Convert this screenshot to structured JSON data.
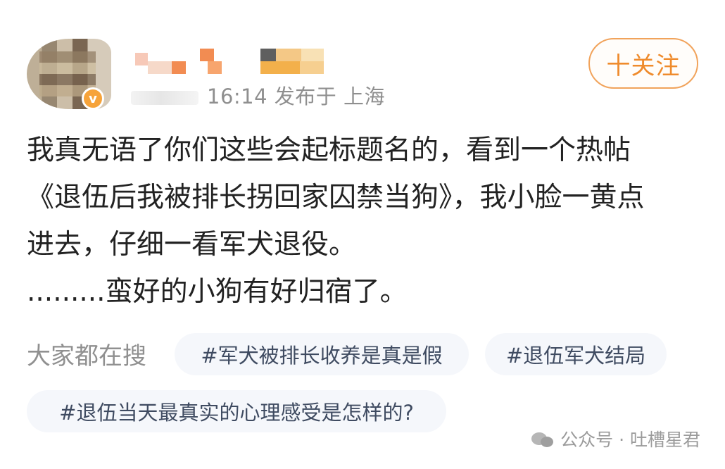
{
  "author": {
    "verified_icon": "v",
    "avatar_icon": "blurred-avatar",
    "name_icon": "mosaic-name"
  },
  "meta": {
    "timestamp_tail": "16:14",
    "publish_location": "发布于 上海"
  },
  "actions": {
    "follow_label": "十关注"
  },
  "post": {
    "content": "我真无语了你们这些会起标题名的，看到一个热帖\n《退伍后我被排长拐回家囚禁当狗》，我小脸一黄点\n进去，仔细一看军犬退役。\n.........蛮好的小狗有好归宿了。"
  },
  "search": {
    "label": "大家都在搜",
    "tags": [
      "#军犬被排长收养是真是假",
      "#退伍军犬结局",
      "#退伍当天最真实的心理感受是怎样的?"
    ]
  },
  "watermark": {
    "text": "公众号 · 吐槽星君",
    "icon": "wechat-icon"
  },
  "colors": {
    "accent": "#ef8b2c",
    "tag_background": "#f5f7fb",
    "muted_text": "#909090"
  }
}
